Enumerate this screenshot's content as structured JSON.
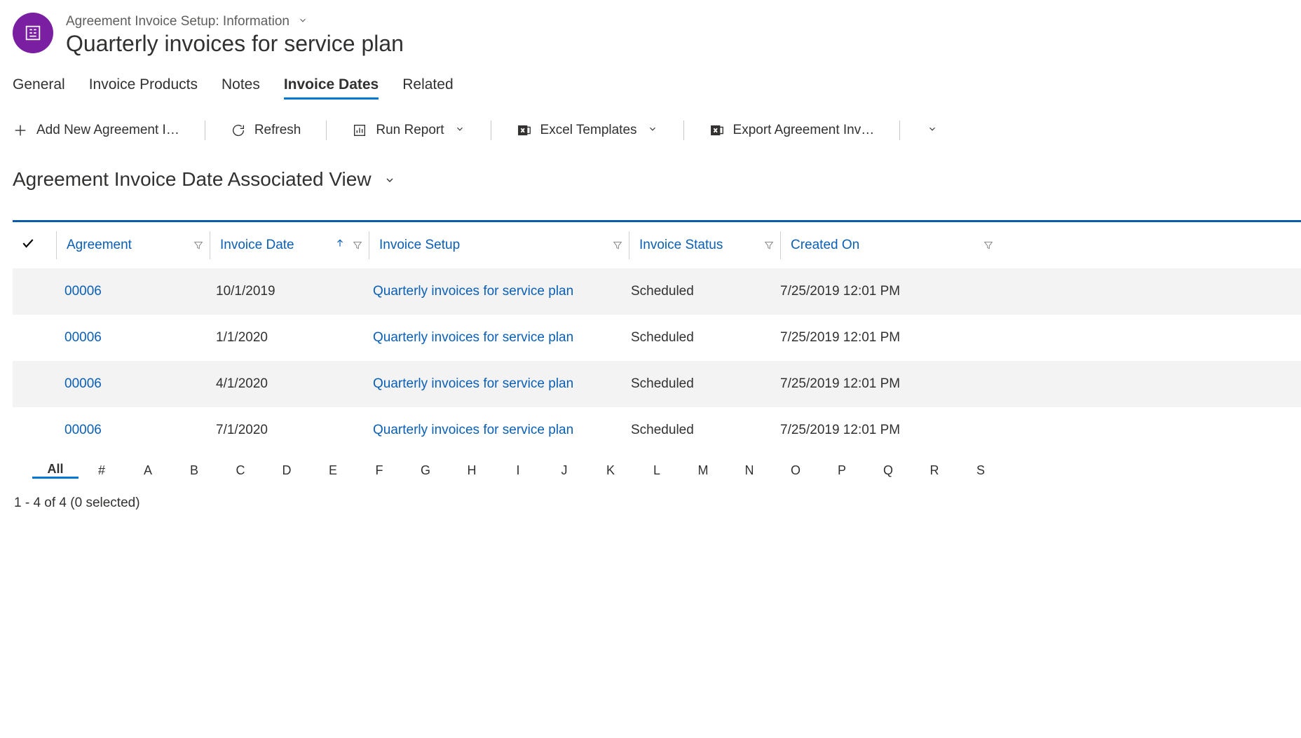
{
  "header": {
    "breadcrumb": "Agreement Invoice Setup: Information",
    "title": "Quarterly invoices for service plan"
  },
  "tabs": [
    {
      "label": "General",
      "active": false
    },
    {
      "label": "Invoice Products",
      "active": false
    },
    {
      "label": "Notes",
      "active": false
    },
    {
      "label": "Invoice Dates",
      "active": true
    },
    {
      "label": "Related",
      "active": false
    }
  ],
  "commands": {
    "add": "Add New Agreement I…",
    "refresh": "Refresh",
    "run_report": "Run Report",
    "excel_templates": "Excel Templates",
    "export": "Export Agreement Inv…"
  },
  "view": {
    "title": "Agreement Invoice Date Associated View"
  },
  "grid": {
    "columns": {
      "agreement": "Agreement",
      "invoice_date": "Invoice Date",
      "invoice_setup": "Invoice Setup",
      "invoice_status": "Invoice Status",
      "created_on": "Created On"
    },
    "sort": {
      "column": "invoice_date",
      "direction": "asc"
    },
    "rows": [
      {
        "agreement": "00006",
        "invoice_date": "10/1/2019",
        "invoice_setup": "Quarterly invoices for service plan",
        "invoice_status": "Scheduled",
        "created_on": "7/25/2019 12:01 PM"
      },
      {
        "agreement": "00006",
        "invoice_date": "1/1/2020",
        "invoice_setup": "Quarterly invoices for service plan",
        "invoice_status": "Scheduled",
        "created_on": "7/25/2019 12:01 PM"
      },
      {
        "agreement": "00006",
        "invoice_date": "4/1/2020",
        "invoice_setup": "Quarterly invoices for service plan",
        "invoice_status": "Scheduled",
        "created_on": "7/25/2019 12:01 PM"
      },
      {
        "agreement": "00006",
        "invoice_date": "7/1/2020",
        "invoice_setup": "Quarterly invoices for service plan",
        "invoice_status": "Scheduled",
        "created_on": "7/25/2019 12:01 PM"
      }
    ]
  },
  "alpha_bar": [
    "All",
    "#",
    "A",
    "B",
    "C",
    "D",
    "E",
    "F",
    "G",
    "H",
    "I",
    "J",
    "K",
    "L",
    "M",
    "N",
    "O",
    "P",
    "Q",
    "R",
    "S"
  ],
  "alpha_selected": "All",
  "status": "1 - 4 of 4 (0 selected)",
  "icons": {
    "chevron": "⌄"
  }
}
